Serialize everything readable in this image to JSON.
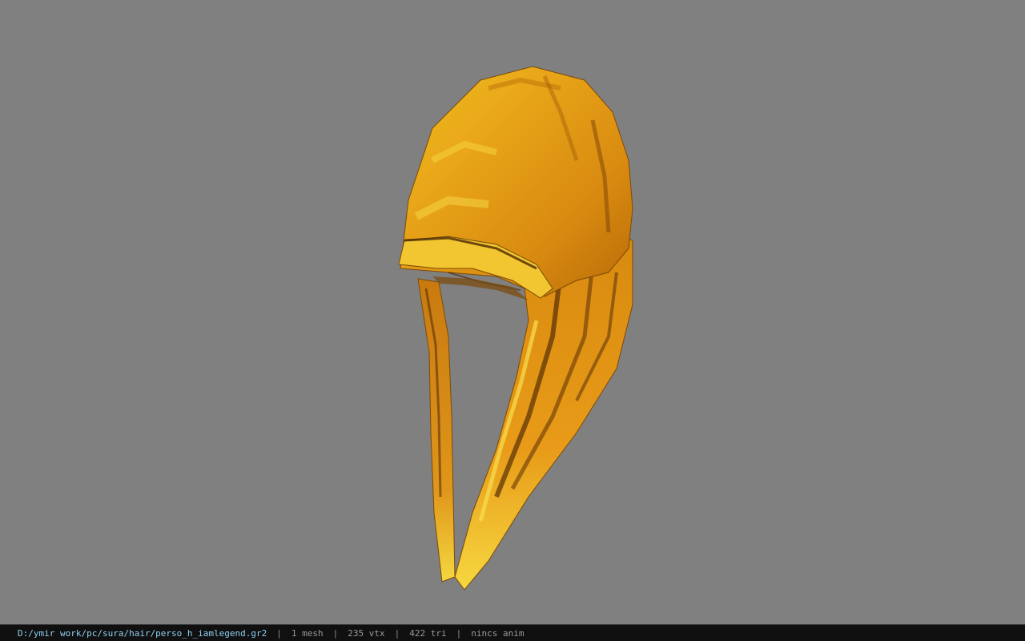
{
  "viewport": {
    "background_color": "#808080",
    "model_icon": "hood-3d-model"
  },
  "status_bar": {
    "file_path": "D:/ymir work/pc/sura/hair/perso_h_iamlegend.gr2",
    "separator": "|",
    "mesh_count": "1 mesh",
    "vertex_count": "235 vtx",
    "triangle_count": "422 tri",
    "anim_status": "nincs anim",
    "path_color": "#8fcff0",
    "text_color": "#9a9a9a"
  }
}
